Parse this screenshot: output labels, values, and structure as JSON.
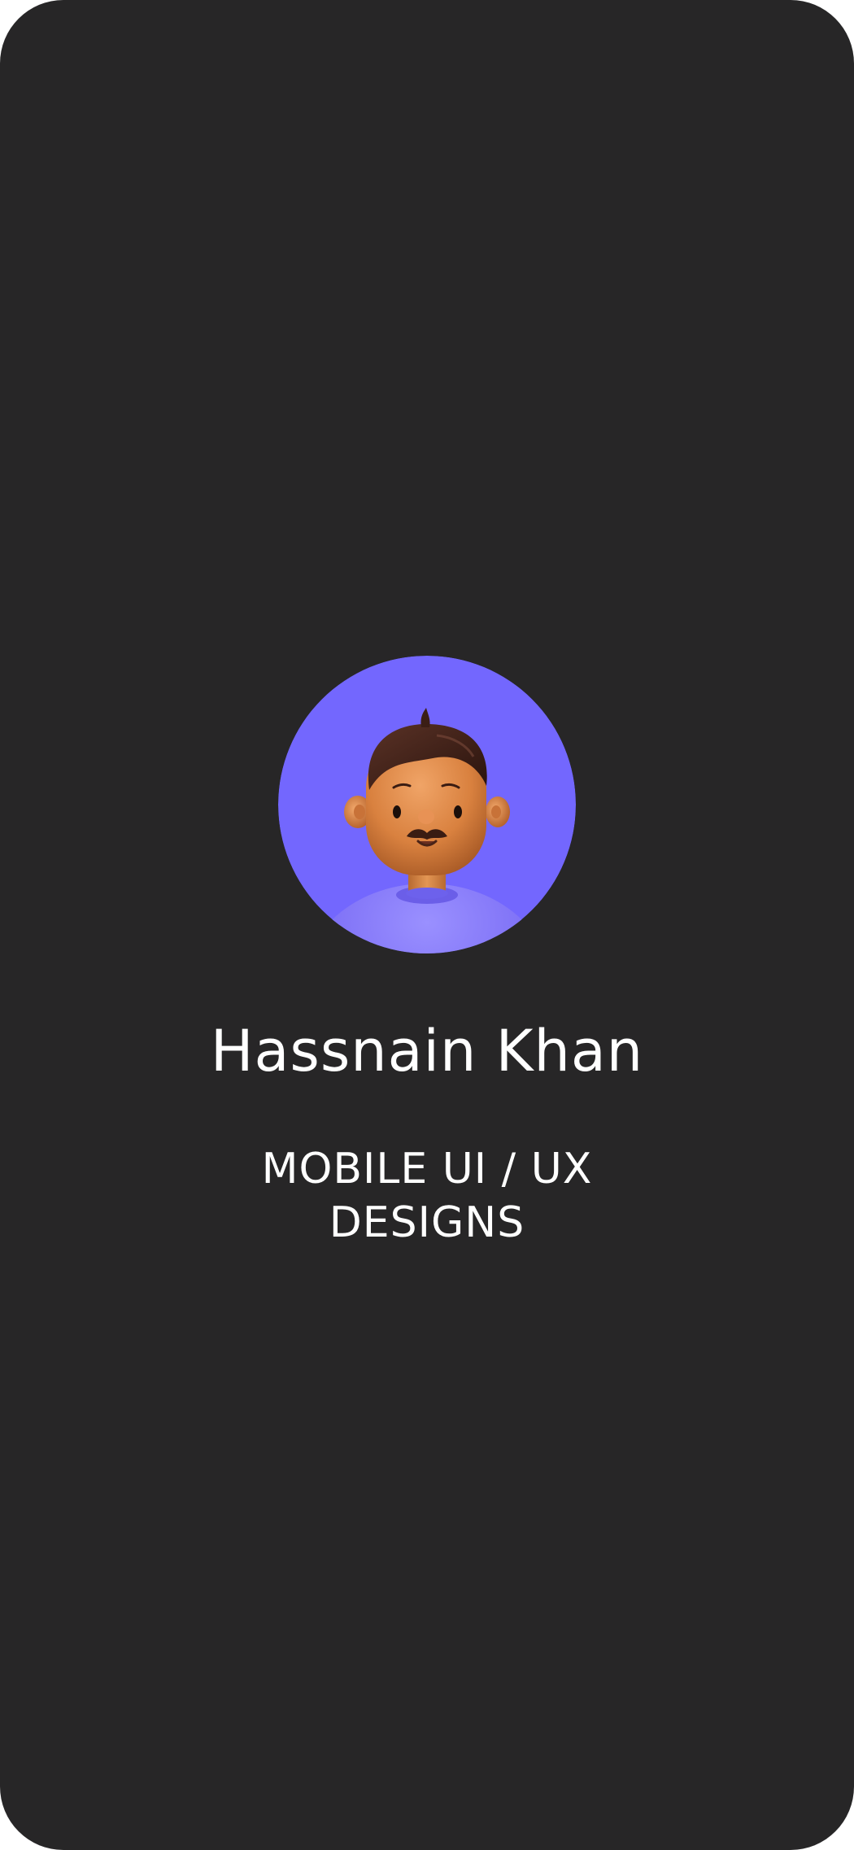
{
  "profile": {
    "name": "Hassnain Khan",
    "subtitle": "MOBILE UI / UX DESIGNS",
    "avatar_icon": "avatar-3d-man-mustache-icon"
  },
  "colors": {
    "screen_background": "#272627",
    "avatar_background": "#7367FE",
    "text": "#FFFFFF"
  }
}
